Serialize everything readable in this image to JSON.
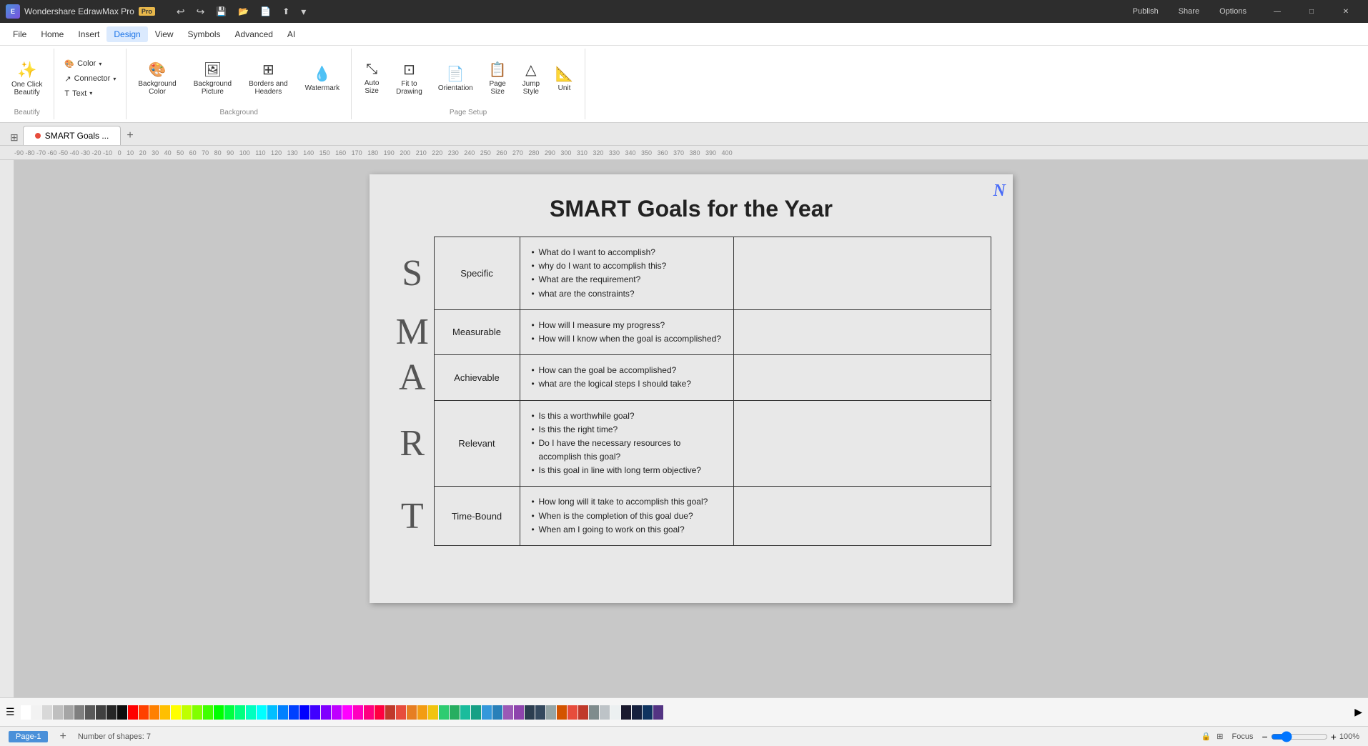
{
  "app": {
    "name": "Wondershare EdrawMax Pro",
    "pro_badge": "Pro",
    "tab_title": "SMART Goals ...",
    "watermark": "N"
  },
  "title_bar": {
    "undo": "↩",
    "redo": "↪",
    "save": "💾",
    "open": "📂",
    "new": "📄",
    "export": "⬆",
    "more": "▼",
    "publish": "Publish",
    "share": "Share",
    "options": "Options",
    "minimize": "—",
    "maximize": "□",
    "close": "✕"
  },
  "menu": {
    "items": [
      "File",
      "Home",
      "Insert",
      "Design",
      "View",
      "Symbols",
      "Advanced",
      "AI"
    ]
  },
  "ribbon": {
    "beautify_group": "Beautify",
    "background_group": "Background",
    "page_setup_group": "Page Setup",
    "one_click_beautify": "One Click\nBeautify",
    "color_btn": "Color",
    "connector_btn": "Connector",
    "text_btn": "Text",
    "background_color": "Background\nColor",
    "background_picture": "Background\nPicture",
    "borders_headers": "Borders and\nHeaders",
    "watermark": "Watermark",
    "auto_size": "Auto\nSize",
    "fit_to_drawing": "Fit to\nDrawing",
    "orientation": "Orientation",
    "page_size": "Page\nSize",
    "jump_style": "Jump\nStyle",
    "unit": "Unit"
  },
  "diagram": {
    "title": "SMART Goals for the Year",
    "rows": [
      {
        "letter": "S",
        "name": "Specific",
        "questions": [
          "What do I want to accomplish?",
          "why do I want to accomplish this?",
          "What are the requirement?",
          "what are the constraints?"
        ]
      },
      {
        "letter": "M",
        "name": "Measurable",
        "questions": [
          "How will I measure my progress?",
          "How will I know when the goal is accomplished?"
        ]
      },
      {
        "letter": "A",
        "name": "Achievable",
        "questions": [
          "How can the goal be accomplished?",
          "what are the logical steps I should take?"
        ]
      },
      {
        "letter": "R",
        "name": "Relevant",
        "questions": [
          "Is this a worthwhile goal?",
          "Is this the right time?",
          "Do I have the necessary resources to accomplish this goal?",
          "Is this goal in line with long term objective?"
        ]
      },
      {
        "letter": "T",
        "name": "Time-Bound",
        "questions": [
          "How long will it take to accomplish this goal?",
          "When is the completion of this goal due?",
          "When am I going to work on this goal?"
        ]
      }
    ]
  },
  "status_bar": {
    "shapes_count": "Number of shapes: 7",
    "focus": "Focus",
    "zoom": "100%",
    "page_label": "Page-1"
  },
  "colors": [
    "#ffffff",
    "#f2f2f2",
    "#d8d8d8",
    "#bfbfbf",
    "#a5a5a5",
    "#7f7f7f",
    "#595959",
    "#404040",
    "#262626",
    "#0d0d0d",
    "#ff0000",
    "#ff4000",
    "#ff8000",
    "#ffbf00",
    "#ffff00",
    "#bfff00",
    "#80ff00",
    "#40ff00",
    "#00ff00",
    "#00ff40",
    "#00ff80",
    "#00ffbf",
    "#00ffff",
    "#00bfff",
    "#0080ff",
    "#0040ff",
    "#0000ff",
    "#4000ff",
    "#8000ff",
    "#bf00ff",
    "#ff00ff",
    "#ff00bf",
    "#ff0080",
    "#ff0040",
    "#c0392b",
    "#e74c3c",
    "#e67e22",
    "#f39c12",
    "#f1c40f",
    "#2ecc71",
    "#27ae60",
    "#1abc9c",
    "#16a085",
    "#3498db",
    "#2980b9",
    "#9b59b6",
    "#8e44ad",
    "#2c3e50",
    "#34495e",
    "#95a5a6",
    "#d35400",
    "#e74c3c",
    "#c0392b",
    "#7f8c8d",
    "#bdc3c7",
    "#ecf0f1",
    "#1a1a2e",
    "#16213e",
    "#0f3460",
    "#533483"
  ]
}
